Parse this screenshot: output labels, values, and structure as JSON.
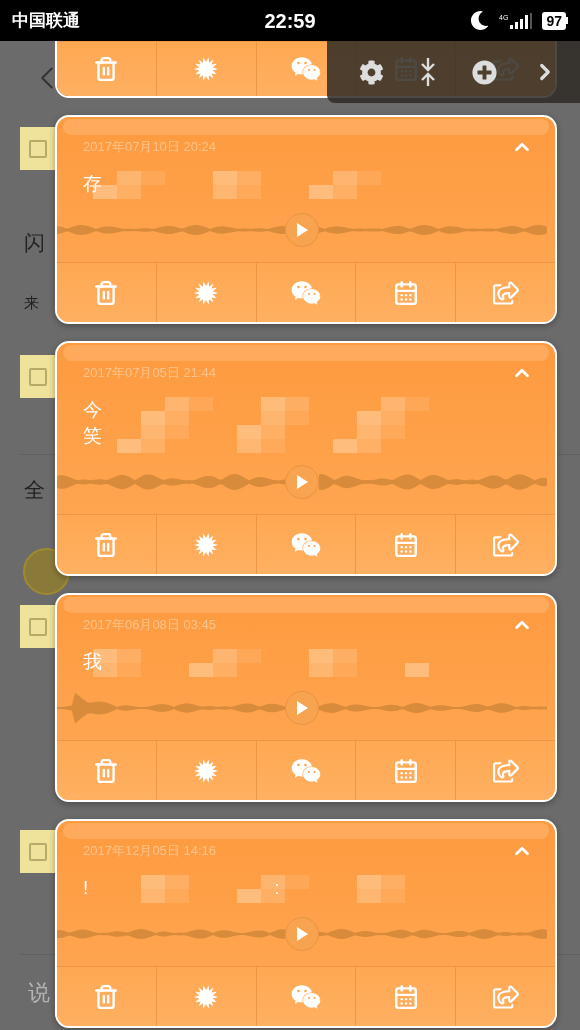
{
  "status_bar": {
    "carrier": "中国联通",
    "time": "22:59",
    "network": "4G",
    "battery": "97"
  },
  "page": {
    "title": "闪",
    "source_label": "来",
    "comments_heading": "全",
    "comment_placeholder": "说",
    "note_checkboxes": [
      {
        "checked": false
      },
      {
        "checked": false
      },
      {
        "checked": false
      },
      {
        "checked": false
      }
    ]
  },
  "cards": [
    {
      "kind": "cut"
    },
    {
      "kind": "full",
      "date": "2017年07月10日 20:24",
      "expanded": true,
      "lines": [
        [
          "存"
        ]
      ]
    },
    {
      "kind": "full",
      "date": "2017年07月05日 21:44",
      "expanded": true,
      "lines": [
        [
          "今"
        ],
        [
          "笑"
        ]
      ]
    },
    {
      "kind": "full",
      "date": "2017年06月08日 03:45",
      "expanded": true,
      "lines": [
        [
          "我"
        ]
      ]
    },
    {
      "kind": "full",
      "date": "2017年12月05日 14:16",
      "expanded": true,
      "lines": [
        [
          "!",
          ":"
        ]
      ]
    }
  ]
}
